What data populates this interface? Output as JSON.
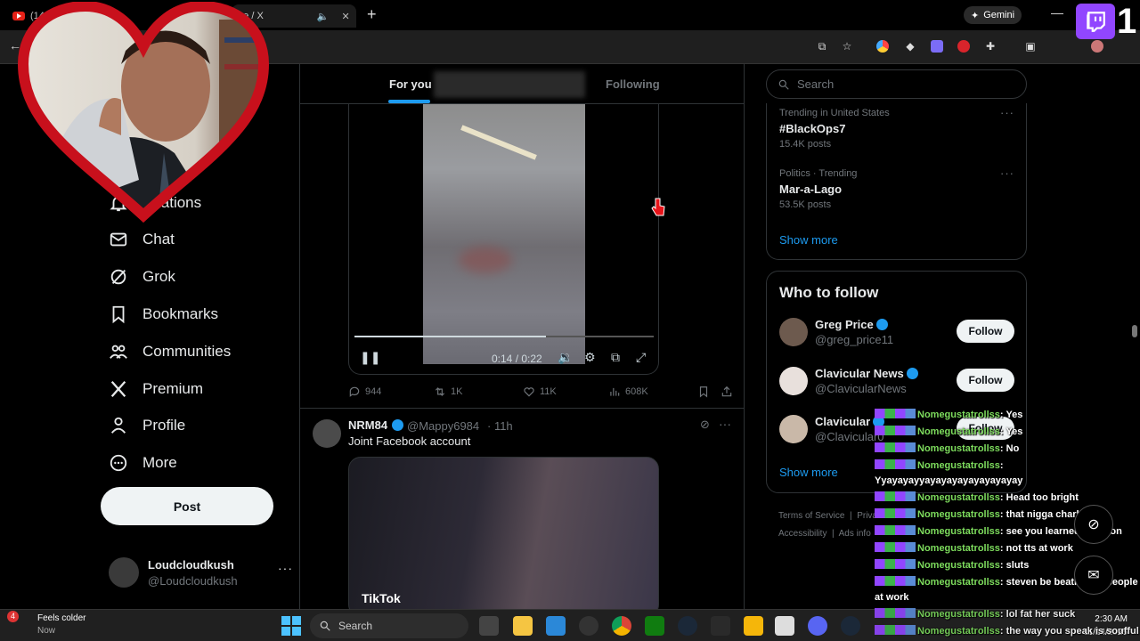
{
  "browser": {
    "tab1_label": "(14",
    "tab2_label": "me / X",
    "gemini_label": "Gemini",
    "minimize": "—",
    "twitch_count": "1"
  },
  "sidebar": {
    "items": [
      {
        "label": "ifications",
        "icon": "bell-icon"
      },
      {
        "label": "Chat",
        "icon": "mail-icon"
      },
      {
        "label": "Grok",
        "icon": "grok-icon"
      },
      {
        "label": "Bookmarks",
        "icon": "bookmark-icon"
      },
      {
        "label": "Communities",
        "icon": "people-icon"
      },
      {
        "label": "Premium",
        "icon": "x-logo-icon"
      },
      {
        "label": "Profile",
        "icon": "person-icon"
      },
      {
        "label": "More",
        "icon": "more-circle-icon"
      }
    ],
    "post_label": "Post",
    "account": {
      "name": "Loudcloudkush",
      "handle": "@Loudcloudkush"
    }
  },
  "feed": {
    "tabs": {
      "for_you": "For you",
      "following": "Following"
    },
    "post1": {
      "video_time": "0:14 / 0:22",
      "progress": 0.64,
      "replies": "944",
      "reposts": "1K",
      "likes": "11K",
      "views": "608K"
    },
    "post2": {
      "name": "NRM84",
      "handle": "@Mappy6984",
      "time": "· 11h",
      "text": "Joint Facebook account",
      "video_watermark": "TikTok"
    }
  },
  "right": {
    "search_placeholder": "Search",
    "trends": [
      {
        "meta": "Trending in United States",
        "title": "#BlackOps7",
        "count": "15.4K posts"
      },
      {
        "meta": "Politics · Trending",
        "title": "Mar-a-Lago",
        "count": "53.5K posts"
      }
    ],
    "show_more": "Show more",
    "who_to_follow": {
      "title": "Who to follow",
      "items": [
        {
          "name": "Greg Price",
          "handle": "@greg_price11",
          "button": "Follow"
        },
        {
          "name": "Clavicular News",
          "handle": "@ClavicularNews",
          "button": "Follow"
        },
        {
          "name": "Clavicular",
          "handle": "@Clavicular0",
          "button": "Follow"
        }
      ],
      "show_more": "Show more"
    },
    "footer": {
      "terms": "Terms of Service",
      "privacy": "Priva",
      "accessibility": "Accessibility",
      "ads": "Ads info"
    }
  },
  "chat": {
    "messages": [
      {
        "user": "Nomegustatrollss",
        "text": ": Yes"
      },
      {
        "user": "Nomegustatrollss",
        "text": ": Yes"
      },
      {
        "user": "Nomegustatrollss",
        "text": ": No"
      },
      {
        "user": "Nomegustatrollss",
        "text": ": Yyayayayyayayayayayayayayay"
      },
      {
        "user": "Nomegustatrollss",
        "text": ": Head too bright"
      },
      {
        "user": "Nomegustatrollss",
        "text": ": that nigga charles"
      },
      {
        "user": "Nomegustatrollss",
        "text": ": see you learned a lesson"
      },
      {
        "user": "Nomegustatrollss",
        "text": ": not tts at work"
      },
      {
        "user": "Nomegustatrollss",
        "text": ": sluts"
      },
      {
        "user": "Nomegustatrollss",
        "text": ": steven be beating up people at work"
      },
      {
        "user": "Nomegustatrollss",
        "text": ": lol fat her suck"
      },
      {
        "user": "Nomegustatrollss",
        "text": ": the way you speak is soufful"
      }
    ]
  },
  "taskbar": {
    "weather_badge": "4",
    "weather_title": "Feels colder",
    "weather_sub": "Now",
    "search_placeholder": "Search",
    "time": "2:30 AM",
    "date": "11/14/2025"
  },
  "colors": {
    "accent": "#1d9bf0",
    "twitch": "#9146ff",
    "chat_user": "#7ddc5d",
    "heart_frame": "#c8101c"
  }
}
